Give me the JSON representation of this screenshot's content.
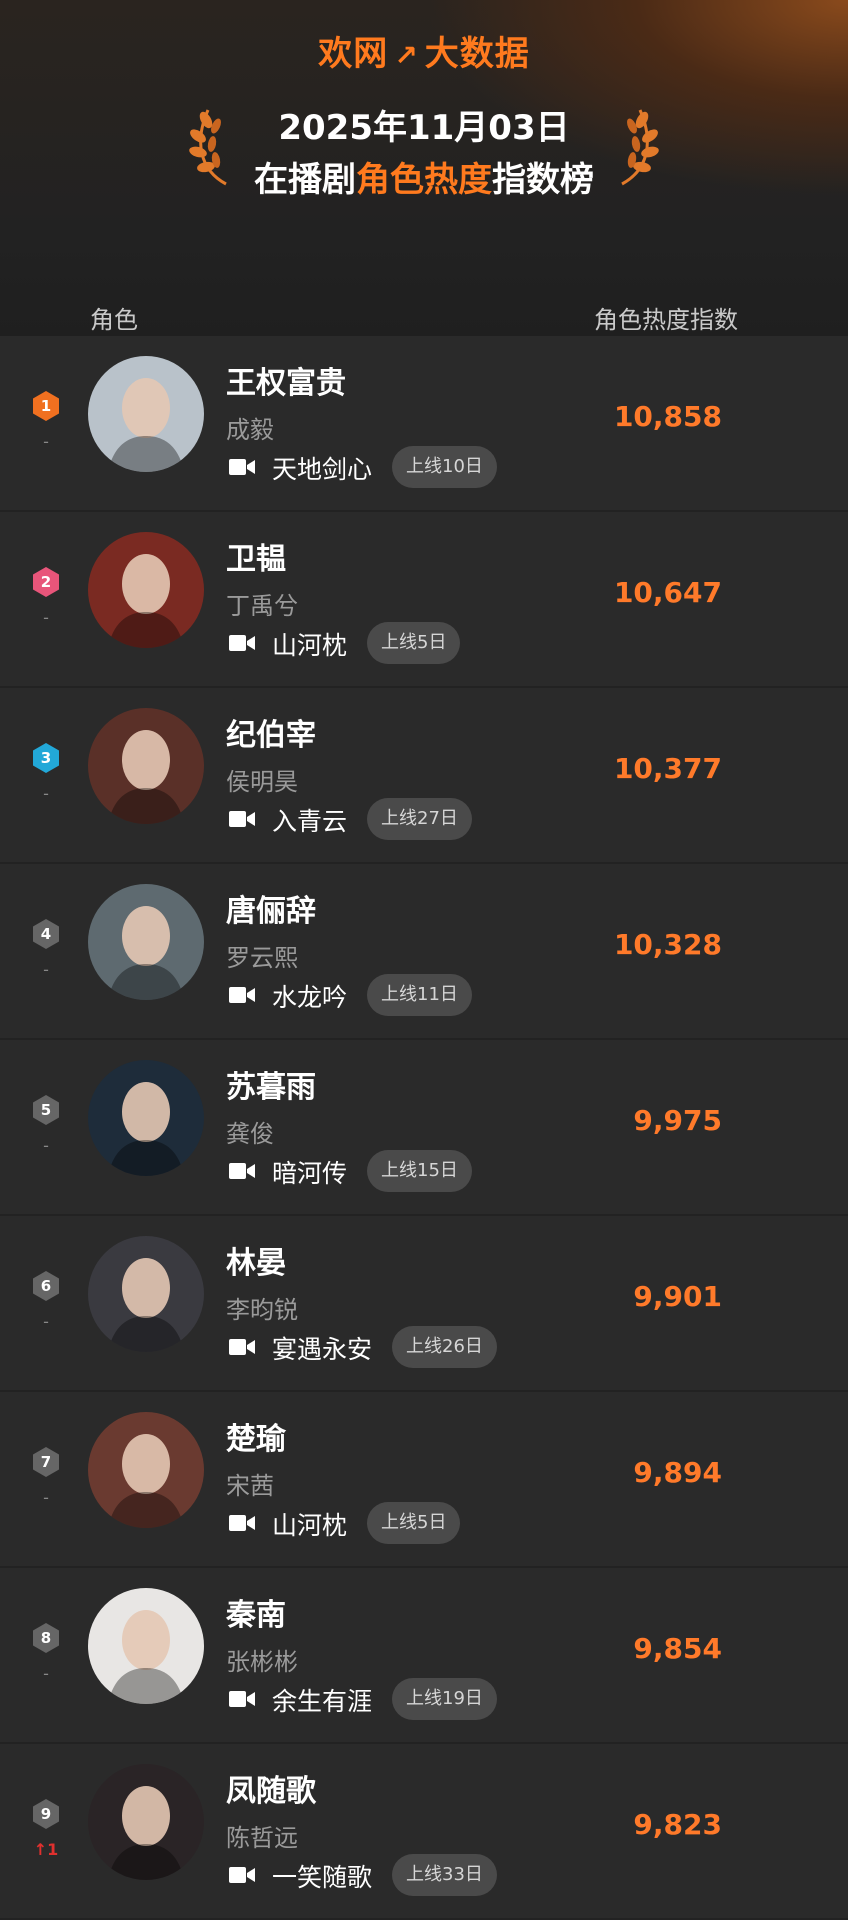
{
  "header": {
    "brand_left": "欢网",
    "brand_right": "大数据",
    "date": "2025年11月03日",
    "title_prefix": "在播剧",
    "title_highlight": "角色热度",
    "title_suffix": "指数榜"
  },
  "columns": {
    "role": "角色",
    "index": "角色热度指数"
  },
  "rows": [
    {
      "rank": "1",
      "change": "-",
      "name": "王权富贵",
      "actor": "成毅",
      "drama": "天地剑心",
      "online": "上线10日",
      "score": "10,858",
      "medal": "#f07020",
      "avatar_color": "#b9c2ca"
    },
    {
      "rank": "2",
      "change": "-",
      "name": "卫韫",
      "actor": "丁禹兮",
      "drama": "山河枕",
      "online": "上线5日",
      "score": "10,647",
      "medal": "#e8557a",
      "avatar_color": "#7a2a22"
    },
    {
      "rank": "3",
      "change": "-",
      "name": "纪伯宰",
      "actor": "侯明昊",
      "drama": "入青云",
      "online": "上线27日",
      "score": "10,377",
      "medal": "#22a8d8",
      "avatar_color": "#5a3028"
    },
    {
      "rank": "4",
      "change": "-",
      "name": "唐俪辞",
      "actor": "罗云熙",
      "drama": "水龙吟",
      "online": "上线11日",
      "score": "10,328",
      "medal": "#666666",
      "avatar_color": "#5e6a70"
    },
    {
      "rank": "5",
      "change": "-",
      "name": "苏暮雨",
      "actor": "龚俊",
      "drama": "暗河传",
      "online": "上线15日",
      "score": "9,975",
      "medal": "#666666",
      "avatar_color": "#1e2c3a"
    },
    {
      "rank": "6",
      "change": "-",
      "name": "林晏",
      "actor": "李昀锐",
      "drama": "宴遇永安",
      "online": "上线26日",
      "score": "9,901",
      "medal": "#666666",
      "avatar_color": "#3a3a40"
    },
    {
      "rank": "7",
      "change": "-",
      "name": "楚瑜",
      "actor": "宋茜",
      "drama": "山河枕",
      "online": "上线5日",
      "score": "9,894",
      "medal": "#666666",
      "avatar_color": "#6a3a30"
    },
    {
      "rank": "8",
      "change": "-",
      "name": "秦南",
      "actor": "张彬彬",
      "drama": "余生有涯",
      "online": "上线19日",
      "score": "9,854",
      "medal": "#666666",
      "avatar_color": "#e8e6e4"
    },
    {
      "rank": "9",
      "change": "↑1",
      "name": "凤随歌",
      "actor": "陈哲远",
      "drama": "一笑随歌",
      "online": "上线33日",
      "score": "9,823",
      "medal": "#666666",
      "avatar_color": "#2a2426"
    }
  ]
}
